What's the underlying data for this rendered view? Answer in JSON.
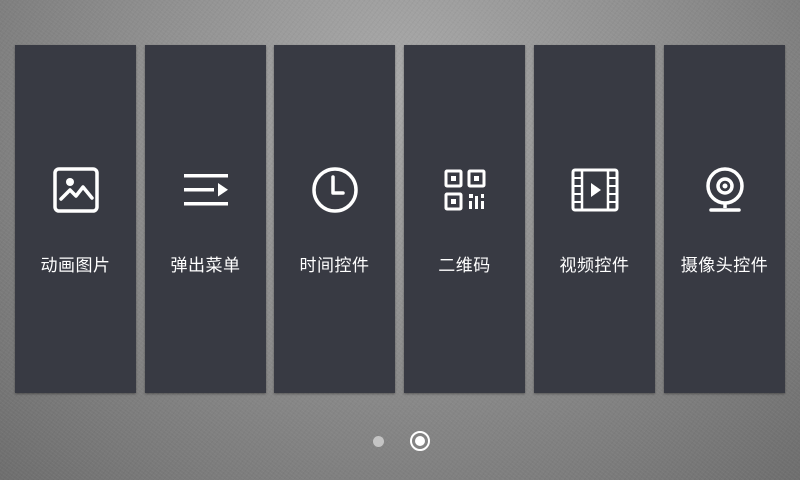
{
  "tiles": [
    {
      "label": "动画图片",
      "icon": "image-icon"
    },
    {
      "label": "弹出菜单",
      "icon": "menu-icon"
    },
    {
      "label": "时间控件",
      "icon": "clock-icon"
    },
    {
      "label": "二维码",
      "icon": "qr-code-icon"
    },
    {
      "label": "视频控件",
      "icon": "video-icon"
    },
    {
      "label": "摄像头控件",
      "icon": "webcam-icon"
    }
  ],
  "pager": {
    "pages": 2,
    "current": 2
  },
  "colors": {
    "tile_background": "#383a43",
    "icon_and_text": "#ffffff",
    "inactive_dot": "#c4c4c4"
  }
}
